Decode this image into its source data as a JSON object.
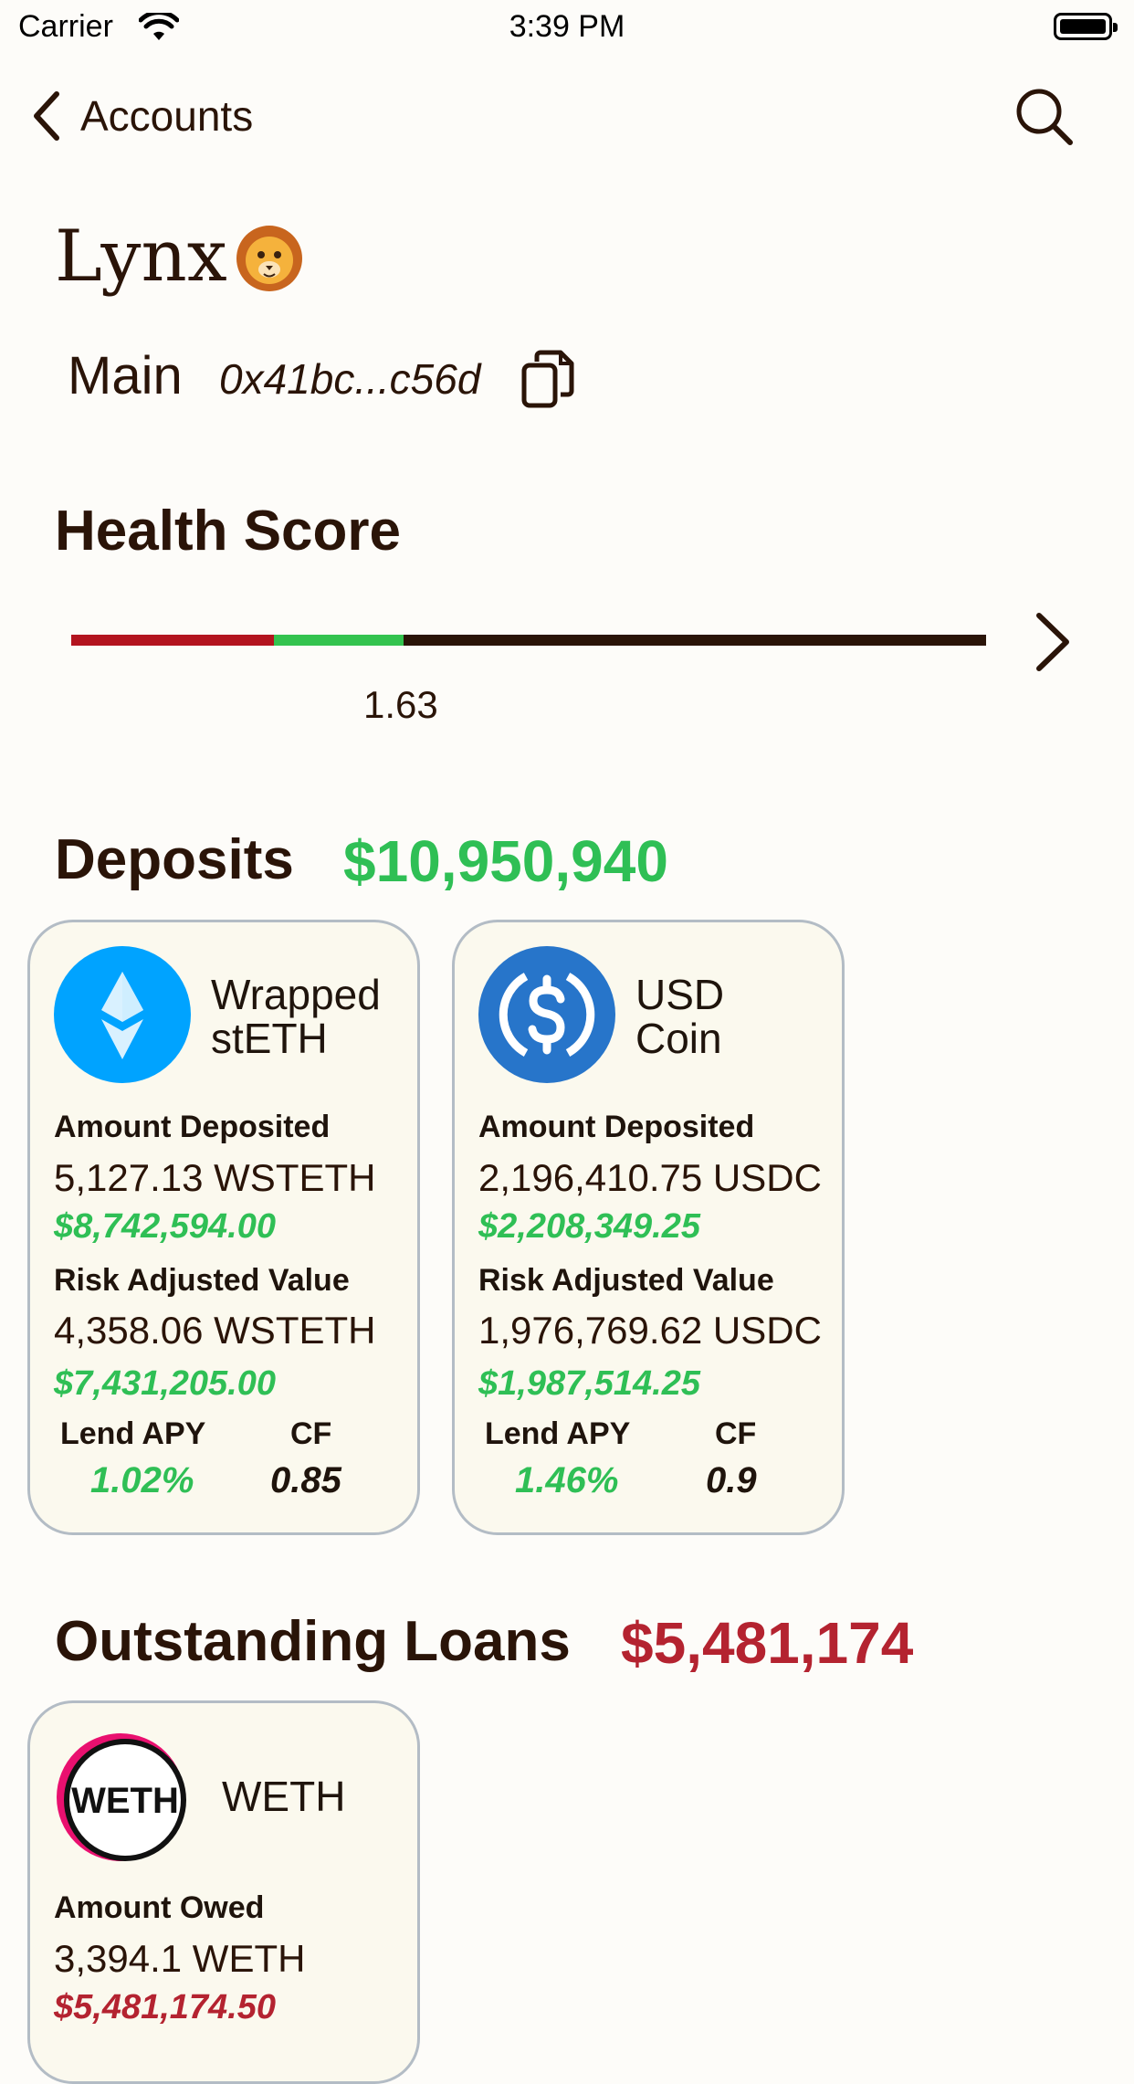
{
  "status_bar": {
    "carrier": "Carrier",
    "time": "3:39 PM"
  },
  "nav": {
    "back_label": "Accounts"
  },
  "profile": {
    "name": "Lynx",
    "account_type": "Main",
    "address": "0x41bc...c56d"
  },
  "health": {
    "title": "Health Score",
    "value": "1.63",
    "colors": {
      "low": "#b3141f",
      "mid": "#33c34f",
      "rest": "#2a1408"
    }
  },
  "deposits": {
    "title": "Deposits",
    "total": "$10,950,940",
    "cards": [
      {
        "name_line1": "Wrapped",
        "name_line2": "stETH",
        "icon": "wsteth-icon",
        "amount_label": "Amount Deposited",
        "amount": "5,127.13 WSTETH",
        "amount_usd": "$8,742,594.00",
        "risk_label": "Risk Adjusted Value",
        "risk_amount": "4,358.06 WSTETH",
        "risk_usd": "$7,431,205.00",
        "apy_label": "Lend APY",
        "apy": "1.02%",
        "cf_label": "CF",
        "cf": "0.85"
      },
      {
        "name_line1": "USD",
        "name_line2": "Coin",
        "icon": "usdc-icon",
        "amount_label": "Amount Deposited",
        "amount": "2,196,410.75 USDC",
        "amount_usd": "$2,208,349.25",
        "risk_label": "Risk Adjusted Value",
        "risk_amount": "1,976,769.62 USDC",
        "risk_usd": "$1,987,514.25",
        "apy_label": "Lend APY",
        "apy": "1.46%",
        "cf_label": "CF",
        "cf": "0.9"
      }
    ]
  },
  "loans": {
    "title": "Outstanding Loans",
    "total": "$5,481,174",
    "cards": [
      {
        "name": "WETH",
        "icon": "weth-icon",
        "logo_text": "WETH",
        "amount_label": "Amount Owed",
        "amount": "3,394.1 WETH",
        "amount_usd": "$5,481,174.50"
      }
    ]
  },
  "colors": {
    "positive": "#2fbf55",
    "negative": "#b42330",
    "card_border": "#b3bcc5",
    "card_bg": "#fbf9ee"
  }
}
